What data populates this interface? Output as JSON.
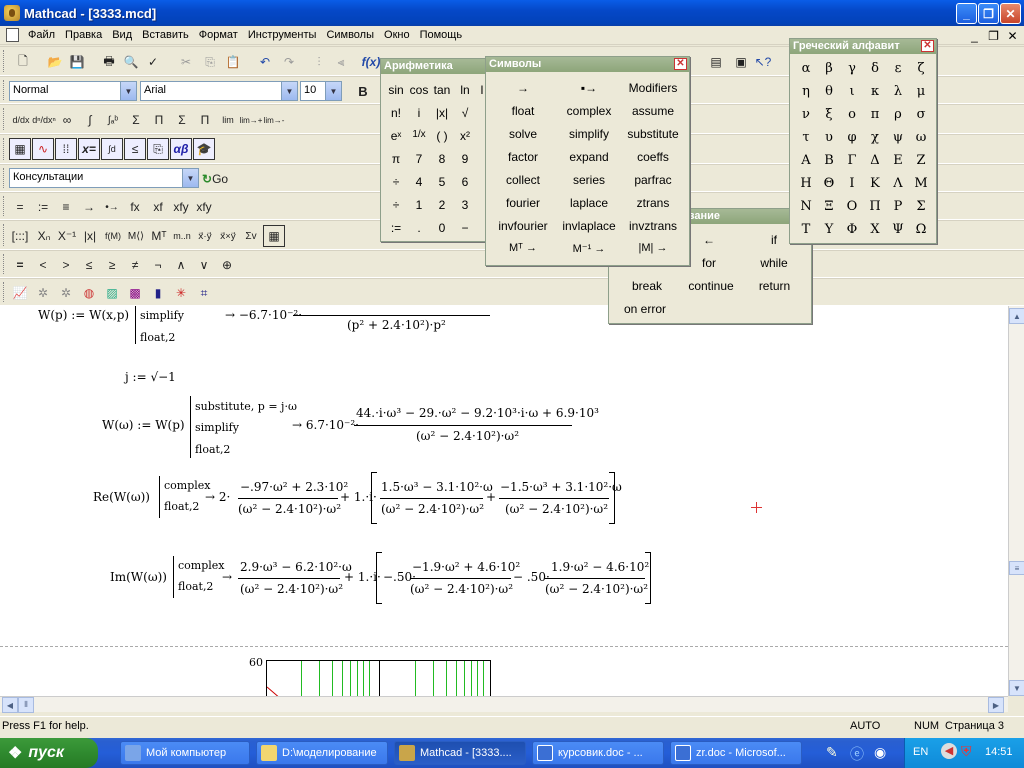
{
  "window": {
    "title": "Mathcad - [3333.mcd]"
  },
  "menu": [
    "Файл",
    "Правка",
    "Вид",
    "Вставить",
    "Формат",
    "Инструменты",
    "Символы",
    "Окно",
    "Помощь"
  ],
  "format_bar": {
    "style": "Normal",
    "font": "Arial",
    "size": "10",
    "bold": "B"
  },
  "resource_bar": {
    "topic": "Консультации",
    "go": "Go"
  },
  "calculus_bar": {
    "items": [
      "d/dx",
      "dⁿ/dxⁿ",
      "∞",
      "∫",
      "∫ₐᵇ",
      "Σ",
      "Π",
      "∮",
      "lim",
      "lim→+",
      "lim→-"
    ]
  },
  "matrix_bar": {
    "items": [
      "[:::]",
      "Xₙ",
      "X⁻¹",
      "|x|",
      "f(M)",
      "M⟨⟩",
      "Mᵀ",
      "m..n",
      "x⃗·y⃗",
      "x⃗×y⃗",
      "Σv"
    ]
  },
  "bool_bar": {
    "items": [
      "=",
      "<",
      ">",
      "≤",
      "≥",
      "≠",
      "¬",
      "∧",
      "∨",
      "⊕"
    ]
  },
  "eval_bar": {
    "items": [
      "=",
      ":=",
      "≡",
      "→",
      "•→",
      "fx",
      "xf",
      "xfy",
      "xfy"
    ]
  },
  "palette_arith": {
    "title": "Арифметика",
    "rows": [
      [
        "sin",
        "cos",
        "tan",
        "ln",
        "l"
      ],
      [
        "n!",
        "i",
        "|x|",
        "√",
        ""
      ],
      [
        "eˣ",
        "1/x",
        "( )",
        "x²",
        ""
      ],
      [
        "π",
        "7",
        "8",
        "9",
        ""
      ],
      [
        "÷",
        "4",
        "5",
        "6",
        ""
      ],
      [
        "÷",
        "1",
        "2",
        "3",
        ""
      ],
      [
        ":=",
        ".",
        "0",
        "−",
        ""
      ]
    ]
  },
  "palette_symbols": {
    "title": "Символы",
    "rows": [
      [
        "→",
        "▪→",
        "Modifiers"
      ],
      [
        "float",
        "complex",
        "assume"
      ],
      [
        "solve",
        "simplify",
        "substitute"
      ],
      [
        "factor",
        "expand",
        "coeffs"
      ],
      [
        "collect",
        "series",
        "parfrac"
      ],
      [
        "fourier",
        "laplace",
        "ztrans"
      ],
      [
        "invfourier",
        "invlaplace",
        "invztrans"
      ],
      [
        "Mᵀ →",
        "M⁻¹ →",
        "|M| →"
      ]
    ]
  },
  "palette_prog": {
    "title": "зание",
    "rows": [
      [
        "←",
        "if"
      ],
      [
        "for",
        "while"
      ],
      [
        "break",
        "continue",
        "return"
      ],
      [
        "on error"
      ]
    ]
  },
  "palette_greek": {
    "title": "Греческий алфавит",
    "letters": [
      "α",
      "β",
      "γ",
      "δ",
      "ε",
      "ζ",
      "η",
      "θ",
      "ι",
      "κ",
      "λ",
      "μ",
      "ν",
      "ξ",
      "ο",
      "π",
      "ρ",
      "σ",
      "τ",
      "υ",
      "φ",
      "χ",
      "ψ",
      "ω",
      "Α",
      "Β",
      "Γ",
      "Δ",
      "Ε",
      "Ζ",
      "Η",
      "Θ",
      "Ι",
      "Κ",
      "Λ",
      "Μ",
      "Ν",
      "Ξ",
      "Ο",
      "Π",
      "Ρ",
      "Σ",
      "Τ",
      "Υ",
      "Φ",
      "Χ",
      "Ψ",
      "Ω"
    ]
  },
  "doc": {
    "eq1": {
      "lhs": "W(p) := W(x,p)",
      "kw1": "simplify",
      "kw2": "float,2",
      "res": "→ −6.7·10⁻²·",
      "den": "(p² + 2.4·10²)·p²"
    },
    "eq2": {
      "text": "j := √−1"
    },
    "eq3": {
      "lhs": "W(ω) := W(p)",
      "kw1": "substitute, p = j·ω",
      "kw2": "simplify",
      "kw3": "float,2",
      "res": "→ 6.7·10⁻²·",
      "num": "44.·i·ω³ − 29.·ω² − 9.2·10³·i·ω + 6.9·10³",
      "den": "(ω² − 2.4·10²)·ω²"
    },
    "eq4": {
      "lhs": "Re(W(ω))",
      "kw1": "complex",
      "kw2": "float,2",
      "res": "→ 2·",
      "n1": "−.97·ω² + 2.3·10²",
      "d1": "(ω² − 2.4·10²)·ω²",
      "mid": "+ 1.·i·",
      "n2": "1.5·ω³ − 3.1·10²·ω",
      "d2": "(ω² − 2.4·10²)·ω²",
      "plus": "+",
      "n3": "−1.5·ω³ + 3.1·10²·ω",
      "d3": "(ω² − 2.4·10²)·ω²"
    },
    "eq5": {
      "lhs": "Im(W(ω))",
      "kw1": "complex",
      "kw2": "float,2",
      "res": "→",
      "n1": "2.9·ω³ − 6.2·10²·ω",
      "d1": "(ω² − 2.4·10²)·ω²",
      "mid": "+ 1.·i·",
      "a": "−.50·",
      "n2": "−1.9·ω² + 4.6·10²",
      "d2": "(ω² − 2.4·10²)·ω²",
      "minus": "− .50·",
      "n3": "1.9·ω² − 4.6·10²",
      "d3": "(ω² − 2.4·10²)·ω²"
    },
    "plot_label": "60"
  },
  "status": {
    "help": "Press F1 for help.",
    "auto": "AUTO",
    "num": "NUM",
    "page": "Страница 3"
  },
  "taskbar": {
    "start": "пуск",
    "tasks": [
      "Мой компьютер",
      "D:\\моделирование",
      "Mathcad - [3333....",
      "курсовик.doc - ...",
      "zr.doc - Microsof..."
    ],
    "lang": "EN",
    "clock": "14:51"
  }
}
